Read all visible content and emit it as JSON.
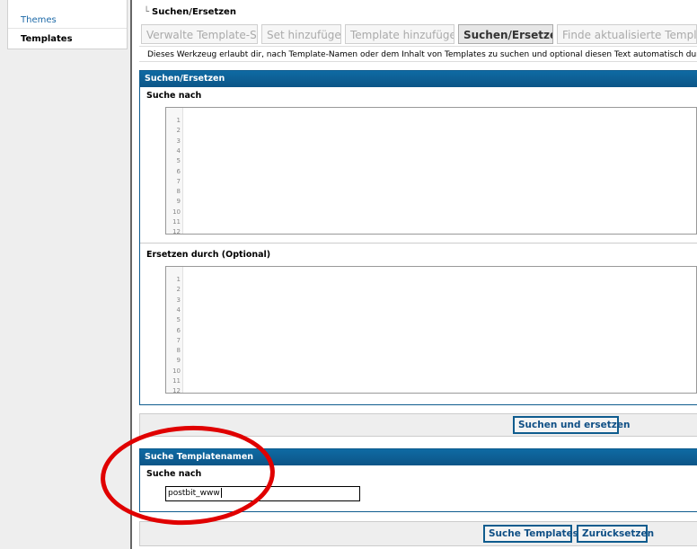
{
  "sidebar": {
    "items": [
      {
        "label": "Themes"
      },
      {
        "label": "Templates"
      }
    ]
  },
  "breadcrumb": "Suchen/Ersetzen",
  "tabs": [
    {
      "label": "Verwalte Template-Set"
    },
    {
      "label": "Set hinzufügen"
    },
    {
      "label": "Template hinzufügen"
    },
    {
      "label": "Suchen/Ersetzen",
      "active": true
    },
    {
      "label": "Finde aktualisierte Templates"
    }
  ],
  "description": "Dieses Werkzeug erlaubt dir, nach Template-Namen oder dem Inhalt von Templates zu suchen und optional diesen Text automatisch durch e",
  "replace_panel": {
    "title": "Suchen/Ersetzen",
    "search_label": "Suche nach",
    "replace_label": "Ersetzen durch (Optional)",
    "search_lines": [
      "1",
      "2",
      "3",
      "4",
      "5",
      "6",
      "7",
      "8",
      "9",
      "10",
      "11",
      "12"
    ],
    "replace_lines": [
      "1",
      "2",
      "3",
      "4",
      "5",
      "6",
      "7",
      "8",
      "9",
      "10",
      "11",
      "12"
    ]
  },
  "replace_button": "Suchen und ersetzen",
  "name_panel": {
    "title": "Suche Templatenamen",
    "search_label": "Suche nach",
    "search_value": "postbit_www"
  },
  "buttons": {
    "search_templates": "Suche Templates",
    "reset": "Zurücksetzen"
  },
  "colors": {
    "header": "#0f5c8e",
    "highlight": "#e00000"
  }
}
